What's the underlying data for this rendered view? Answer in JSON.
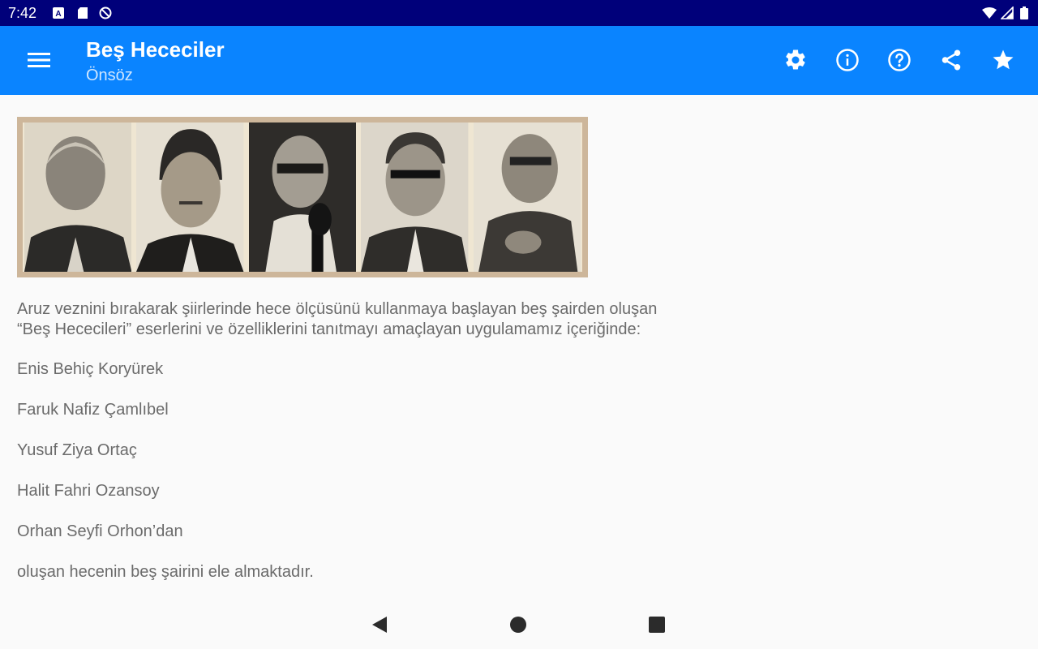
{
  "status_bar": {
    "time": "7:42",
    "left_icons": [
      "keyboard-a-icon",
      "sd-card-icon",
      "no-disturb-icon"
    ],
    "right_icons": [
      "wifi-icon",
      "signal-icon",
      "battery-icon"
    ]
  },
  "app_bar": {
    "title": "Beş Hececiler",
    "subtitle": "Önsöz",
    "color": "#0a84ff",
    "actions": [
      "settings-icon",
      "info-icon",
      "help-icon",
      "share-icon",
      "star-icon"
    ]
  },
  "content": {
    "intro": [
      "Aruz veznini bırakarak şiirlerinde hece ölçüsünü kullanmaya başlayan beş şairden oluşan",
      "“Beş Hececileri” eserlerini ve özelliklerini tanıtmayı amaçlayan uygulamamız içeriğinde:"
    ],
    "poets": [
      "Enis Behiç Koryürek",
      "Faruk Nafiz Çamlıbel",
      "Yusuf Ziya Ortaç",
      "Halit Fahri Ozansoy",
      "Orhan Seyfi Orhon’dan"
    ],
    "closing": "oluşan hecenin beş şairini ele almaktadır."
  },
  "nav_bar": {
    "buttons": [
      "back-icon",
      "home-icon",
      "recents-icon"
    ]
  }
}
